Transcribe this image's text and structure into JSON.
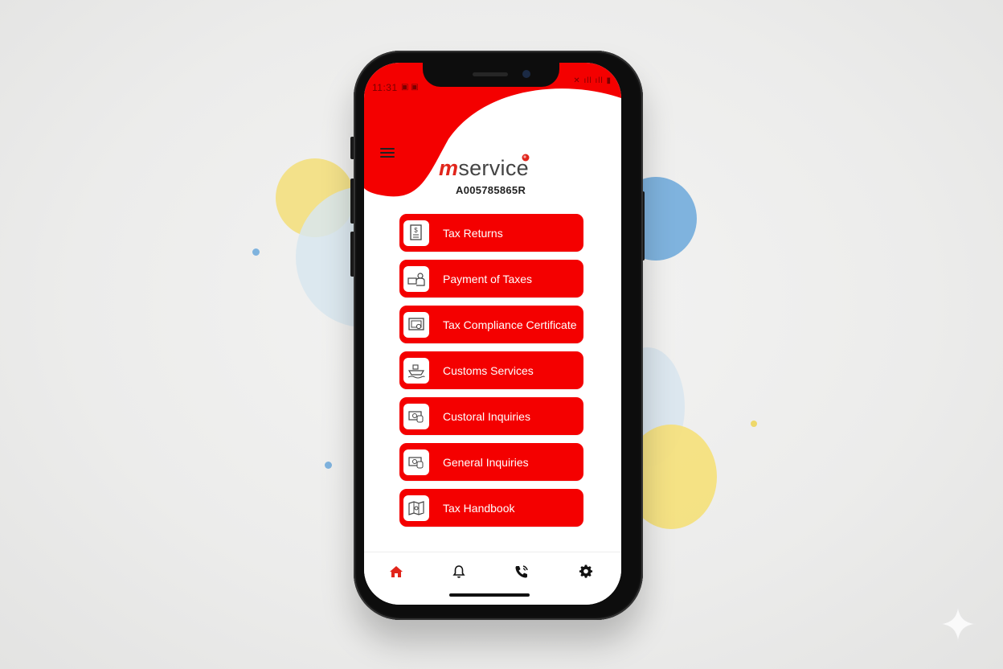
{
  "status_bar": {
    "time": "11:31",
    "left_icons": "▣ ▣",
    "right_icons": "✕ ıll ıll ▮"
  },
  "header": {
    "brand_prefix": "m",
    "brand_suffix": "service",
    "account_number": "A005785865R"
  },
  "menu": [
    {
      "label": "Tax Returns",
      "icon": "tax-document-icon"
    },
    {
      "label": "Payment of Taxes",
      "icon": "payment-icon"
    },
    {
      "label": "Tax Compliance Certificate",
      "icon": "certificate-icon"
    },
    {
      "label": "Customs Services",
      "icon": "ship-icon"
    },
    {
      "label": "Custoral Inquiries",
      "icon": "cash-icon"
    },
    {
      "label": "General Inquiries",
      "icon": "cash-icon"
    },
    {
      "label": "Tax Handbook",
      "icon": "handbook-icon"
    }
  ],
  "bottom_nav": [
    {
      "name": "home",
      "icon": "home-icon",
      "active": true
    },
    {
      "name": "notifications",
      "icon": "bell-icon",
      "active": false
    },
    {
      "name": "call",
      "icon": "phone-icon",
      "active": false
    },
    {
      "name": "settings",
      "icon": "gear-icon",
      "active": false
    }
  ],
  "colors": {
    "brand_red": "#f40000",
    "logo_red": "#e1251b",
    "text_dark": "#222222"
  }
}
